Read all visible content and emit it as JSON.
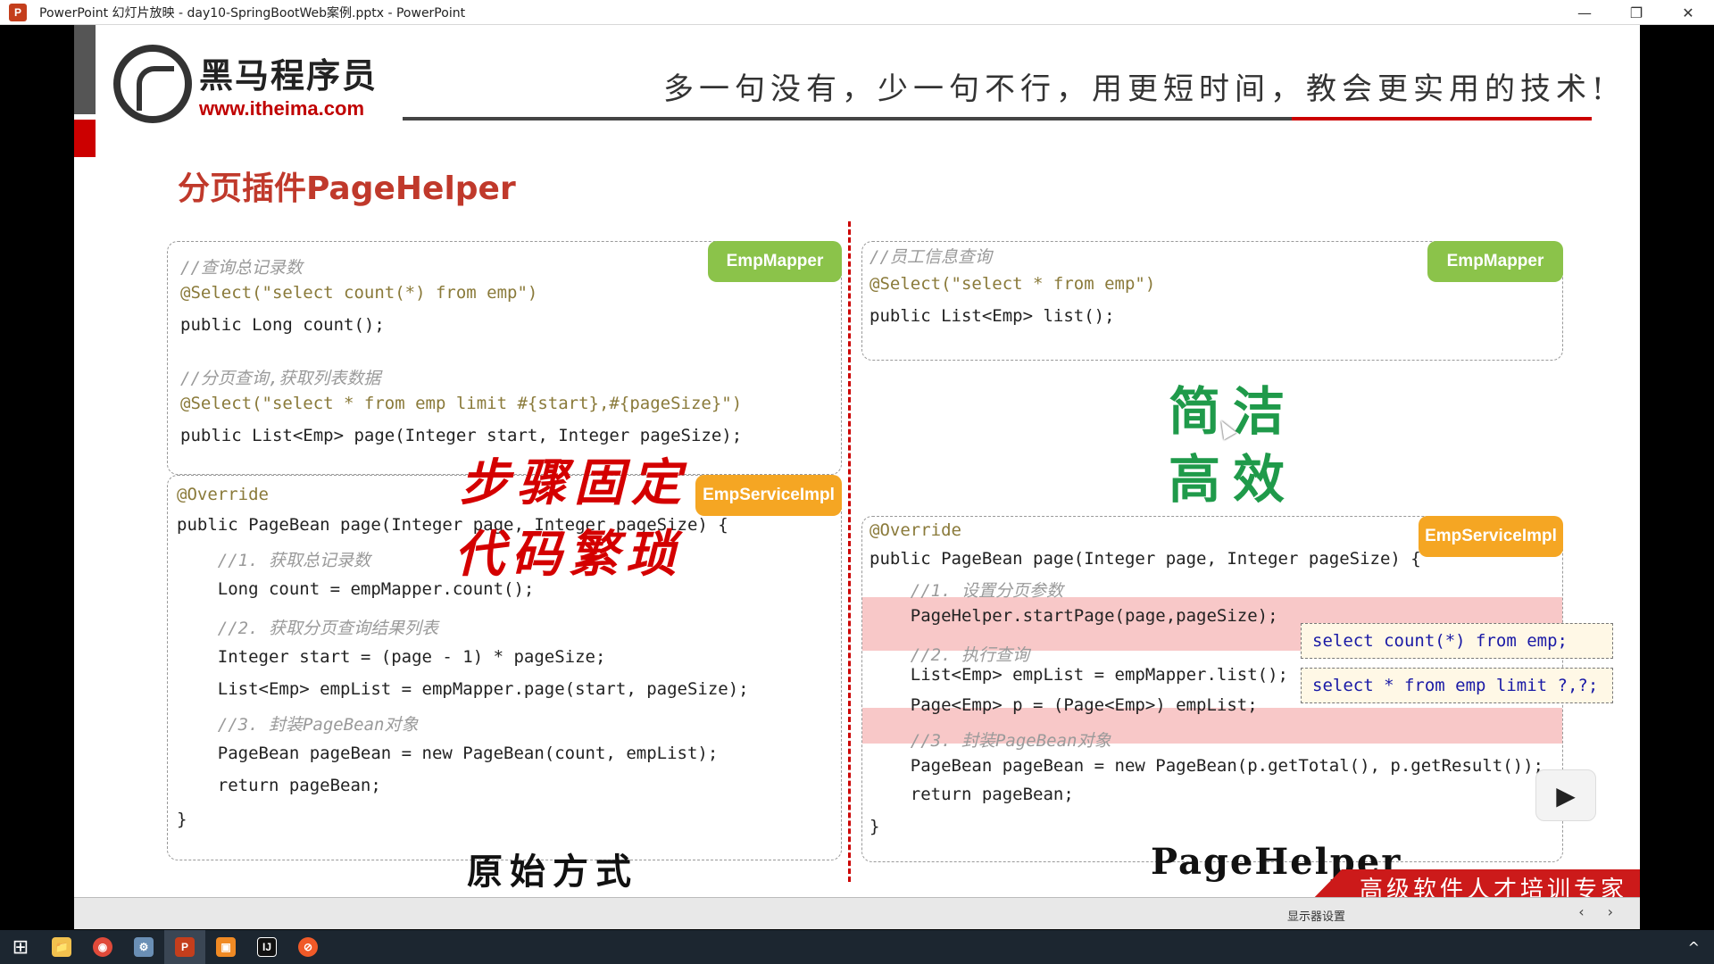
{
  "window": {
    "app_icon": "P",
    "title": "PowerPoint 幻灯片放映  -  day10-SpringBootWeb案例.pptx  -  PowerPoint",
    "minimize": "—",
    "restore": "❐",
    "close": "✕"
  },
  "slide": {
    "logo_cn": "黑马程序员",
    "logo_url": "www.itheima.com",
    "slogan": "多一句没有，少一句不行，用更短时间，教会更实用的技术!",
    "title": "分页插件PageHelper",
    "left": {
      "mapper_tag": "EmpMapper",
      "mapper_lines": [
        "//查询总记录数",
        "@Select(\"select count(*) from emp\")",
        "public Long count();",
        "//分页查询,获取列表数据",
        "@Select(\"select * from emp limit #{start},#{pageSize}\")",
        "public List<Emp> page(Integer start, Integer pageSize);"
      ],
      "service_tag": "EmpServiceImpl",
      "service_lines": [
        "@Override",
        "public PageBean page(Integer page, Integer pageSize) {",
        "    //1. 获取总记录数",
        "    Long count = empMapper.count();",
        "    //2. 获取分页查询结果列表",
        "    Integer start = (page - 1) * pageSize;",
        "    List<Emp> empList = empMapper.page(start, pageSize);",
        "    //3. 封装PageBean对象",
        "    PageBean pageBean = new PageBean(count, empList);",
        "    return pageBean;",
        "}"
      ],
      "overlay_line1": "步骤固定",
      "overlay_line2": "代码繁琐",
      "caption": "原始方式"
    },
    "right": {
      "mapper_tag": "EmpMapper",
      "mapper_lines": [
        "//员工信息查询",
        "@Select(\"select * from emp\")",
        "public List<Emp> list();"
      ],
      "green_line1": "简洁",
      "green_line2": "高效",
      "service_tag": "EmpServiceImpl",
      "service_lines": [
        "@Override",
        "public PageBean page(Integer page, Integer pageSize) {",
        "    //1. 设置分页参数",
        "    PageHelper.startPage(page,pageSize);",
        "    //2. 执行查询",
        "    List<Emp> empList = empMapper.list();",
        "    Page<Emp> p = (Page<Emp>) empList;",
        "    //3. 封装PageBean对象",
        "    PageBean pageBean = new PageBean(p.getTotal(), p.getResult());",
        "    return pageBean;",
        "}"
      ],
      "sql1": "select count(*) from emp;",
      "sql2": "select * from emp limit ?,?;",
      "caption": "PageHelper"
    },
    "banner": "高级软件人才培训专家"
  },
  "slideshow_bar": {
    "display_settings": "显示器设置",
    "prev": "‹",
    "next": "›"
  },
  "taskbar": {
    "start": "⊞",
    "items": [
      "📁",
      "◉",
      "⚙",
      "P",
      "▣",
      "IJ",
      "⊘"
    ],
    "tray": "^"
  },
  "colors": {
    "accent_red": "#cc0000",
    "tag_green": "#8bc34a",
    "tag_orange": "#f5a623",
    "highlight": "#f8c8c8"
  }
}
